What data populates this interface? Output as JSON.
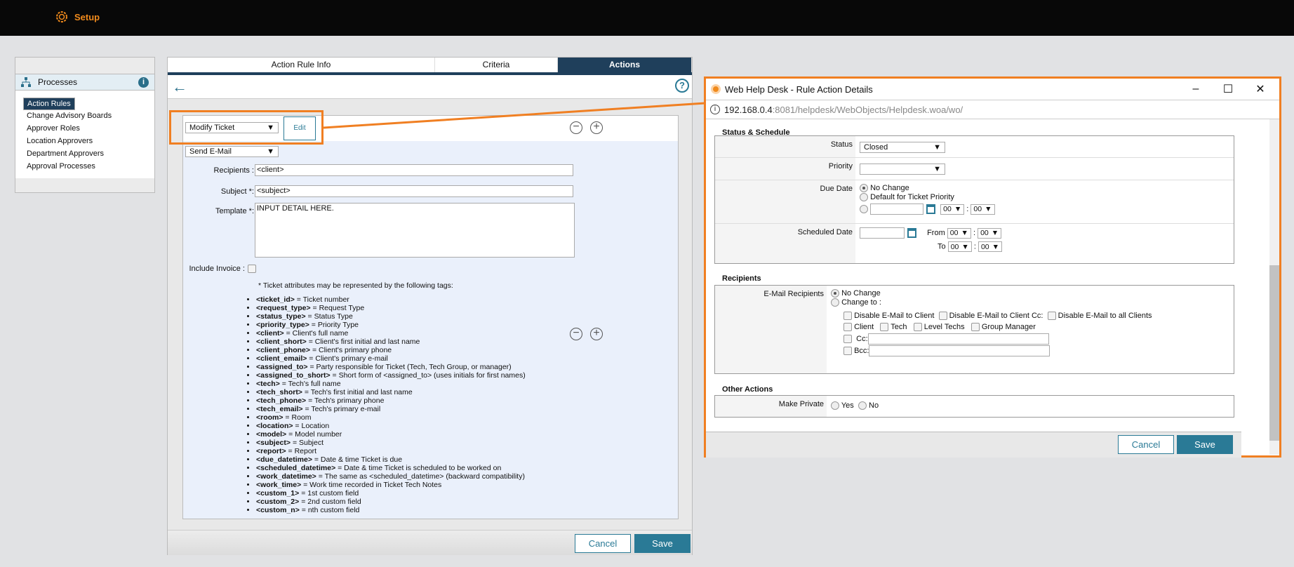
{
  "header": {
    "title": "Setup",
    "icon": "gear-icon",
    "accent": "#f08a1c"
  },
  "sidebar": {
    "section": "Processes",
    "items": [
      {
        "label": "Action Rules",
        "selected": true
      },
      {
        "label": "Change Advisory Boards"
      },
      {
        "label": "Approver Roles"
      },
      {
        "label": "Location Approvers"
      },
      {
        "label": "Department Approvers"
      },
      {
        "label": "Approval Processes"
      }
    ]
  },
  "tabs": [
    {
      "label": "Action Rule Info"
    },
    {
      "label": "Criteria"
    },
    {
      "label": "Actions",
      "active": true
    }
  ],
  "action1": {
    "type": "Modify Ticket",
    "edit_label": "Edit"
  },
  "action2": {
    "type": "Send E-Mail",
    "recipients_label": "Recipients :",
    "recipients_value": "<client>",
    "subject_label": "Subject *:",
    "subject_value": "<subject>",
    "template_label": "Template *:",
    "template_value": "INPUT DETAIL HERE.",
    "invoice_label": "Include Invoice :",
    "tags_note": "* Ticket attributes may be represented by the following tags:",
    "tags": [
      {
        "tag": "<ticket_id>",
        "desc": " = Ticket number"
      },
      {
        "tag": "<request_type>",
        "desc": " = Request Type"
      },
      {
        "tag": "<status_type>",
        "desc": " = Status Type"
      },
      {
        "tag": "<priority_type>",
        "desc": " = Priority Type"
      },
      {
        "tag": "<client>",
        "desc": " = Client's full name"
      },
      {
        "tag": "<client_short>",
        "desc": " = Client's first initial and last name"
      },
      {
        "tag": "<client_phone>",
        "desc": " = Client's primary phone"
      },
      {
        "tag": "<client_email>",
        "desc": " = Client's primary e-mail"
      },
      {
        "tag": "<assigned_to>",
        "desc": " = Party responsible for Ticket (Tech, Tech Group, or manager)"
      },
      {
        "tag": "<assigned_to_short>",
        "desc": " = Short form of <assigned_to> (uses initials for first names)"
      },
      {
        "tag": "<tech>",
        "desc": " = Tech's full name"
      },
      {
        "tag": "<tech_short>",
        "desc": " = Tech's first initial and last name"
      },
      {
        "tag": "<tech_phone>",
        "desc": " = Tech's primary phone"
      },
      {
        "tag": "<tech_email>",
        "desc": " = Tech's primary e-mail"
      },
      {
        "tag": "<room>",
        "desc": " = Room"
      },
      {
        "tag": "<location>",
        "desc": " = Location"
      },
      {
        "tag": "<model>",
        "desc": " = Model number"
      },
      {
        "tag": "<subject>",
        "desc": " = Subject"
      },
      {
        "tag": "<report>",
        "desc": " = Report"
      },
      {
        "tag": "<due_datetime>",
        "desc": " = Date & time Ticket is due"
      },
      {
        "tag": "<scheduled_datetime>",
        "desc": " = Date & time Ticket is scheduled to be worked on"
      },
      {
        "tag": "<work_datetime>",
        "desc": " = The same as <scheduled_datetime> (backward compatibility)"
      },
      {
        "tag": "<work_time>",
        "desc": " = Work time recorded in Ticket Tech Notes"
      },
      {
        "tag": "<custom_1>",
        "desc": " = 1st custom field"
      },
      {
        "tag": "<custom_2>",
        "desc": " = 2nd custom field"
      },
      {
        "tag": "<custom_n>",
        "desc": " = nth custom field"
      }
    ]
  },
  "footer": {
    "cancel": "Cancel",
    "save": "Save"
  },
  "popup": {
    "title": "Web Help Desk - Rule Action Details",
    "url_host": "192.168.0.4",
    "url_rest": ":8081/helpdesk/WebObjects/Helpdesk.woa/wo/",
    "status_section": "Status & Schedule",
    "status_label": "Status",
    "status_value": "Closed",
    "priority_label": "Priority",
    "priority_value": "",
    "due_label": "Due Date",
    "due_opt1": "No Change",
    "due_opt2": "Default for Ticket Priority",
    "hour": "00",
    "minute": "00",
    "colon": ":",
    "sched_label": "Scheduled Date",
    "from_label": "From",
    "to_label": "To",
    "recipients_section": "Recipients",
    "email_label": "E-Mail Recipients",
    "rec_opt1": "No Change",
    "rec_opt2": "Change to :",
    "disable1": "Disable E-Mail to Client",
    "disable2": "Disable E-Mail to Client Cc:",
    "disable3": "Disable E-Mail to all Clients",
    "c_client": "Client",
    "c_tech": "Tech",
    "c_level": "Level Techs",
    "c_group": "Group Manager",
    "cc_label": "Cc:",
    "bcc_label": "Bcc:",
    "other_section": "Other Actions",
    "private_label": "Make Private",
    "yes": "Yes",
    "no": "No",
    "cancel": "Cancel",
    "save": "Save"
  }
}
